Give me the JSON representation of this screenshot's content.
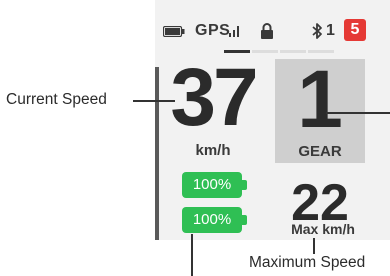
{
  "status_bar": {
    "battery_icon": "battery-icon",
    "gps_label": "GPS",
    "gps_signal_icon": "signal-bars-icon",
    "lock_icon": "lock-icon",
    "bluetooth_icon": "bluetooth-icon",
    "bluetooth_count": "1",
    "notification_count": "5"
  },
  "page_indicator": {
    "total": 4,
    "active": 1
  },
  "speed": {
    "value": "37",
    "unit": "km/h"
  },
  "gear": {
    "value": "1",
    "label": "GEAR"
  },
  "batteries": [
    {
      "label": "100%",
      "level": 1.0
    },
    {
      "label": "100%",
      "level": 1.0
    }
  ],
  "max_speed": {
    "value": "22",
    "unit": "Max km/h"
  },
  "callouts": {
    "current_speed": "Current Speed",
    "maximum_speed": "Maximum Speed"
  },
  "colors": {
    "battery_green": "#2fbf54",
    "badge_red": "#e53935",
    "gear_box": "#cfcfcf",
    "screen_bg": "#f2f2f2"
  }
}
